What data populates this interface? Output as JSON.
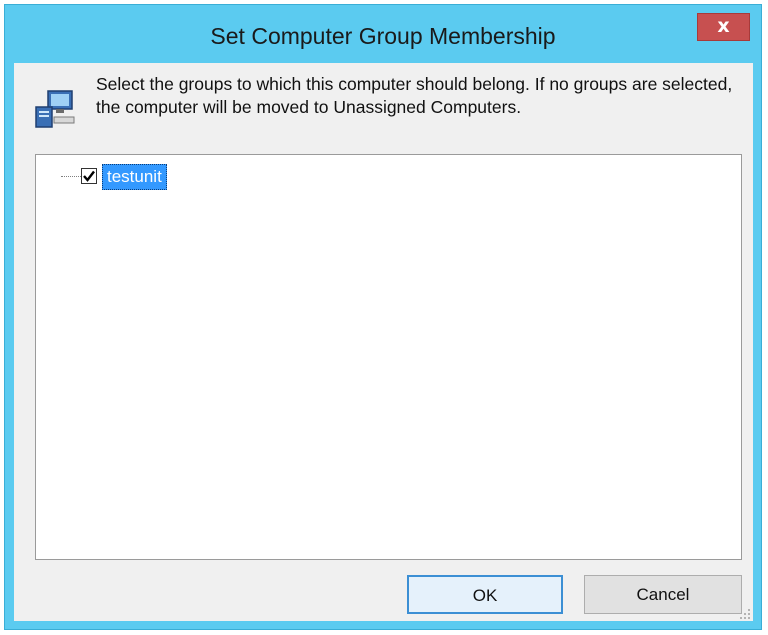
{
  "window": {
    "title": "Set Computer Group Membership",
    "close_label": "x"
  },
  "instructions": "Select the groups to which this computer should belong. If no groups are selected, the computer will be moved to Unassigned Computers.",
  "groups": [
    {
      "label": "testunit",
      "checked": true,
      "selected": true
    }
  ],
  "buttons": {
    "ok_label": "OK",
    "cancel_label": "Cancel"
  },
  "icons": {
    "dialog_icon": "computer-icon",
    "close_icon": "close-icon"
  },
  "colors": {
    "title_bar": "#5bcbf0",
    "close_button": "#c75050",
    "selection": "#3399ff",
    "default_button_border": "#3c8fd4"
  }
}
